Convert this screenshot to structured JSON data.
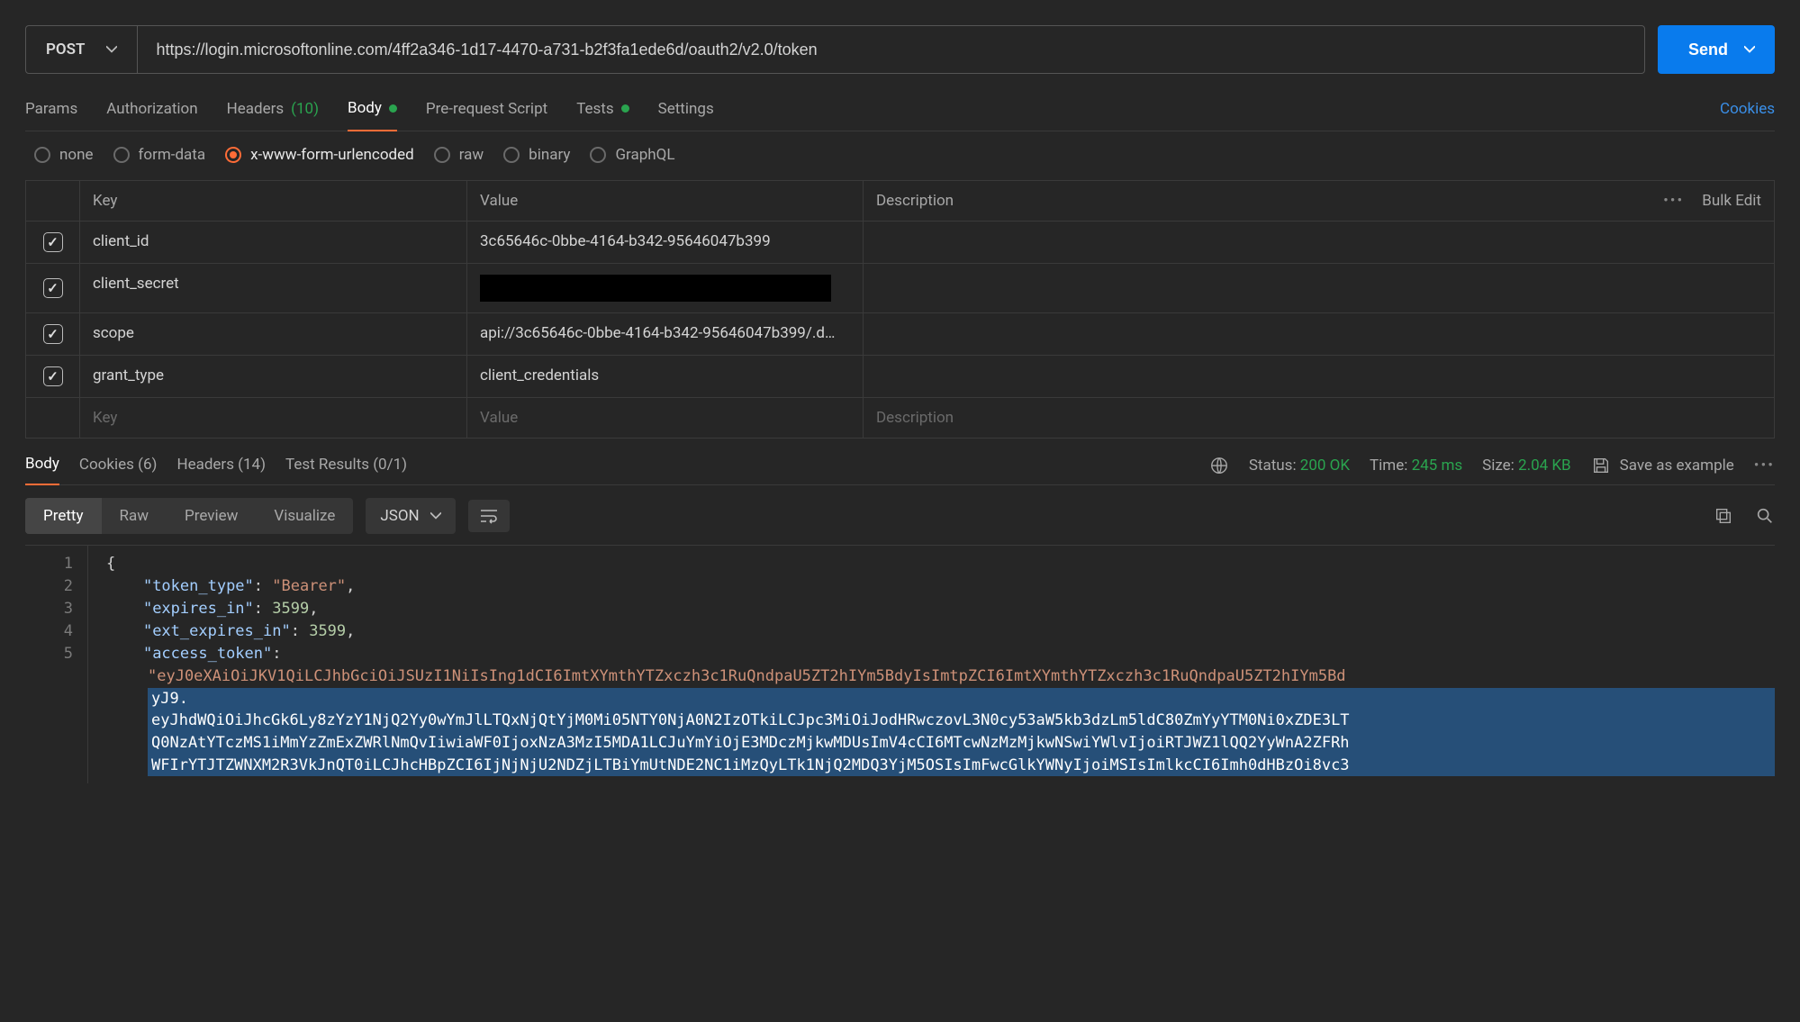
{
  "request": {
    "method": "POST",
    "url": "https://login.microsoftonline.com/4ff2a346-1d17-4470-a731-b2f3fa1ede6d/oauth2/v2.0/token",
    "send_label": "Send"
  },
  "req_tabs": {
    "params": "Params",
    "auth": "Authorization",
    "headers_label": "Headers",
    "headers_count": "(10)",
    "body": "Body",
    "prereq": "Pre-request Script",
    "tests": "Tests",
    "settings": "Settings",
    "cookies": "Cookies"
  },
  "body_types": {
    "none": "none",
    "form": "form-data",
    "xwww": "x-www-form-urlencoded",
    "raw": "raw",
    "binary": "binary",
    "graphql": "GraphQL"
  },
  "param_headers": {
    "key": "Key",
    "value": "Value",
    "desc": "Description",
    "bulk": "Bulk Edit"
  },
  "params": [
    {
      "key": "client_id",
      "value": "3c65646c-0bbe-4164-b342-95646047b399",
      "redacted": false
    },
    {
      "key": "client_secret",
      "value": "",
      "redacted": true
    },
    {
      "key": "scope",
      "value": "api://3c65646c-0bbe-4164-b342-95646047b399/.d…",
      "redacted": false
    },
    {
      "key": "grant_type",
      "value": "client_credentials",
      "redacted": false
    }
  ],
  "param_placeholders": {
    "key": "Key",
    "value": "Value",
    "desc": "Description"
  },
  "resp_tabs": {
    "body": "Body",
    "cookies": "Cookies (6)",
    "headers": "Headers (14)",
    "tests": "Test Results (0/1)"
  },
  "resp_meta": {
    "status_label": "Status:",
    "status_value": "200 OK",
    "time_label": "Time:",
    "time_value": "245 ms",
    "size_label": "Size:",
    "size_value": "2.04 KB",
    "save_example": "Save as example"
  },
  "view": {
    "pretty": "Pretty",
    "raw": "Raw",
    "preview": "Preview",
    "visualize": "Visualize",
    "format": "JSON"
  },
  "response_body": {
    "line1": "{",
    "token_type_k": "\"token_type\"",
    "token_type_v": "\"Bearer\"",
    "expires_in_k": "\"expires_in\"",
    "expires_in_v": "3599",
    "ext_expires_in_k": "\"ext_expires_in\"",
    "ext_expires_in_v": "3599",
    "access_token_k": "\"access_token\"",
    "token_str_open": "\"eyJ0eXAiOiJKV1QiLCJhbGciOiJSUzI1NiIsIng1dCI6ImtXYmthYTZxczh3c1RuQndpaU5ZT2hIYm5BdyIsImtpZCI6ImtXYmthYTZxczh3c1RuQndpaU5ZT2hIYm5Bd",
    "token_line2": "yJ9.",
    "token_line3": "eyJhdWQiOiJhcGk6Ly8zYzY1NjQ2Yy0wYmJlLTQxNjQtYjM0Mi05NTY0NjA0N2IzOTkiLCJpc3MiOiJodHRwczovL3N0cy53aW5kb3dzLm5ldC80ZmYyYTM0Ni0xZDE3LT",
    "token_line4": "Q0NzAtYTczMS1iMmYzZmExZWRlNmQvIiwiaWF0IjoxNzA3MzI5MDA1LCJuYmYiOjE3MDczMjkwMDUsImV4cCI6MTcwNzMzMjkwNSwiYWlvIjoiRTJWZ1lQQ2YyWnA2ZFRh",
    "token_line5": "WFIrYTJTZWNXM2R3VkJnQT0iLCJhcHBpZCI6IjNjNjU2NDZjLTBiYmUtNDE2NC1iMzQyLTk1NjQ2MDQ3YjM5OSIsImFwcGlkYWNyIjoiMSIsImlkcCI6Imh0dHBzOi8vc3"
  }
}
